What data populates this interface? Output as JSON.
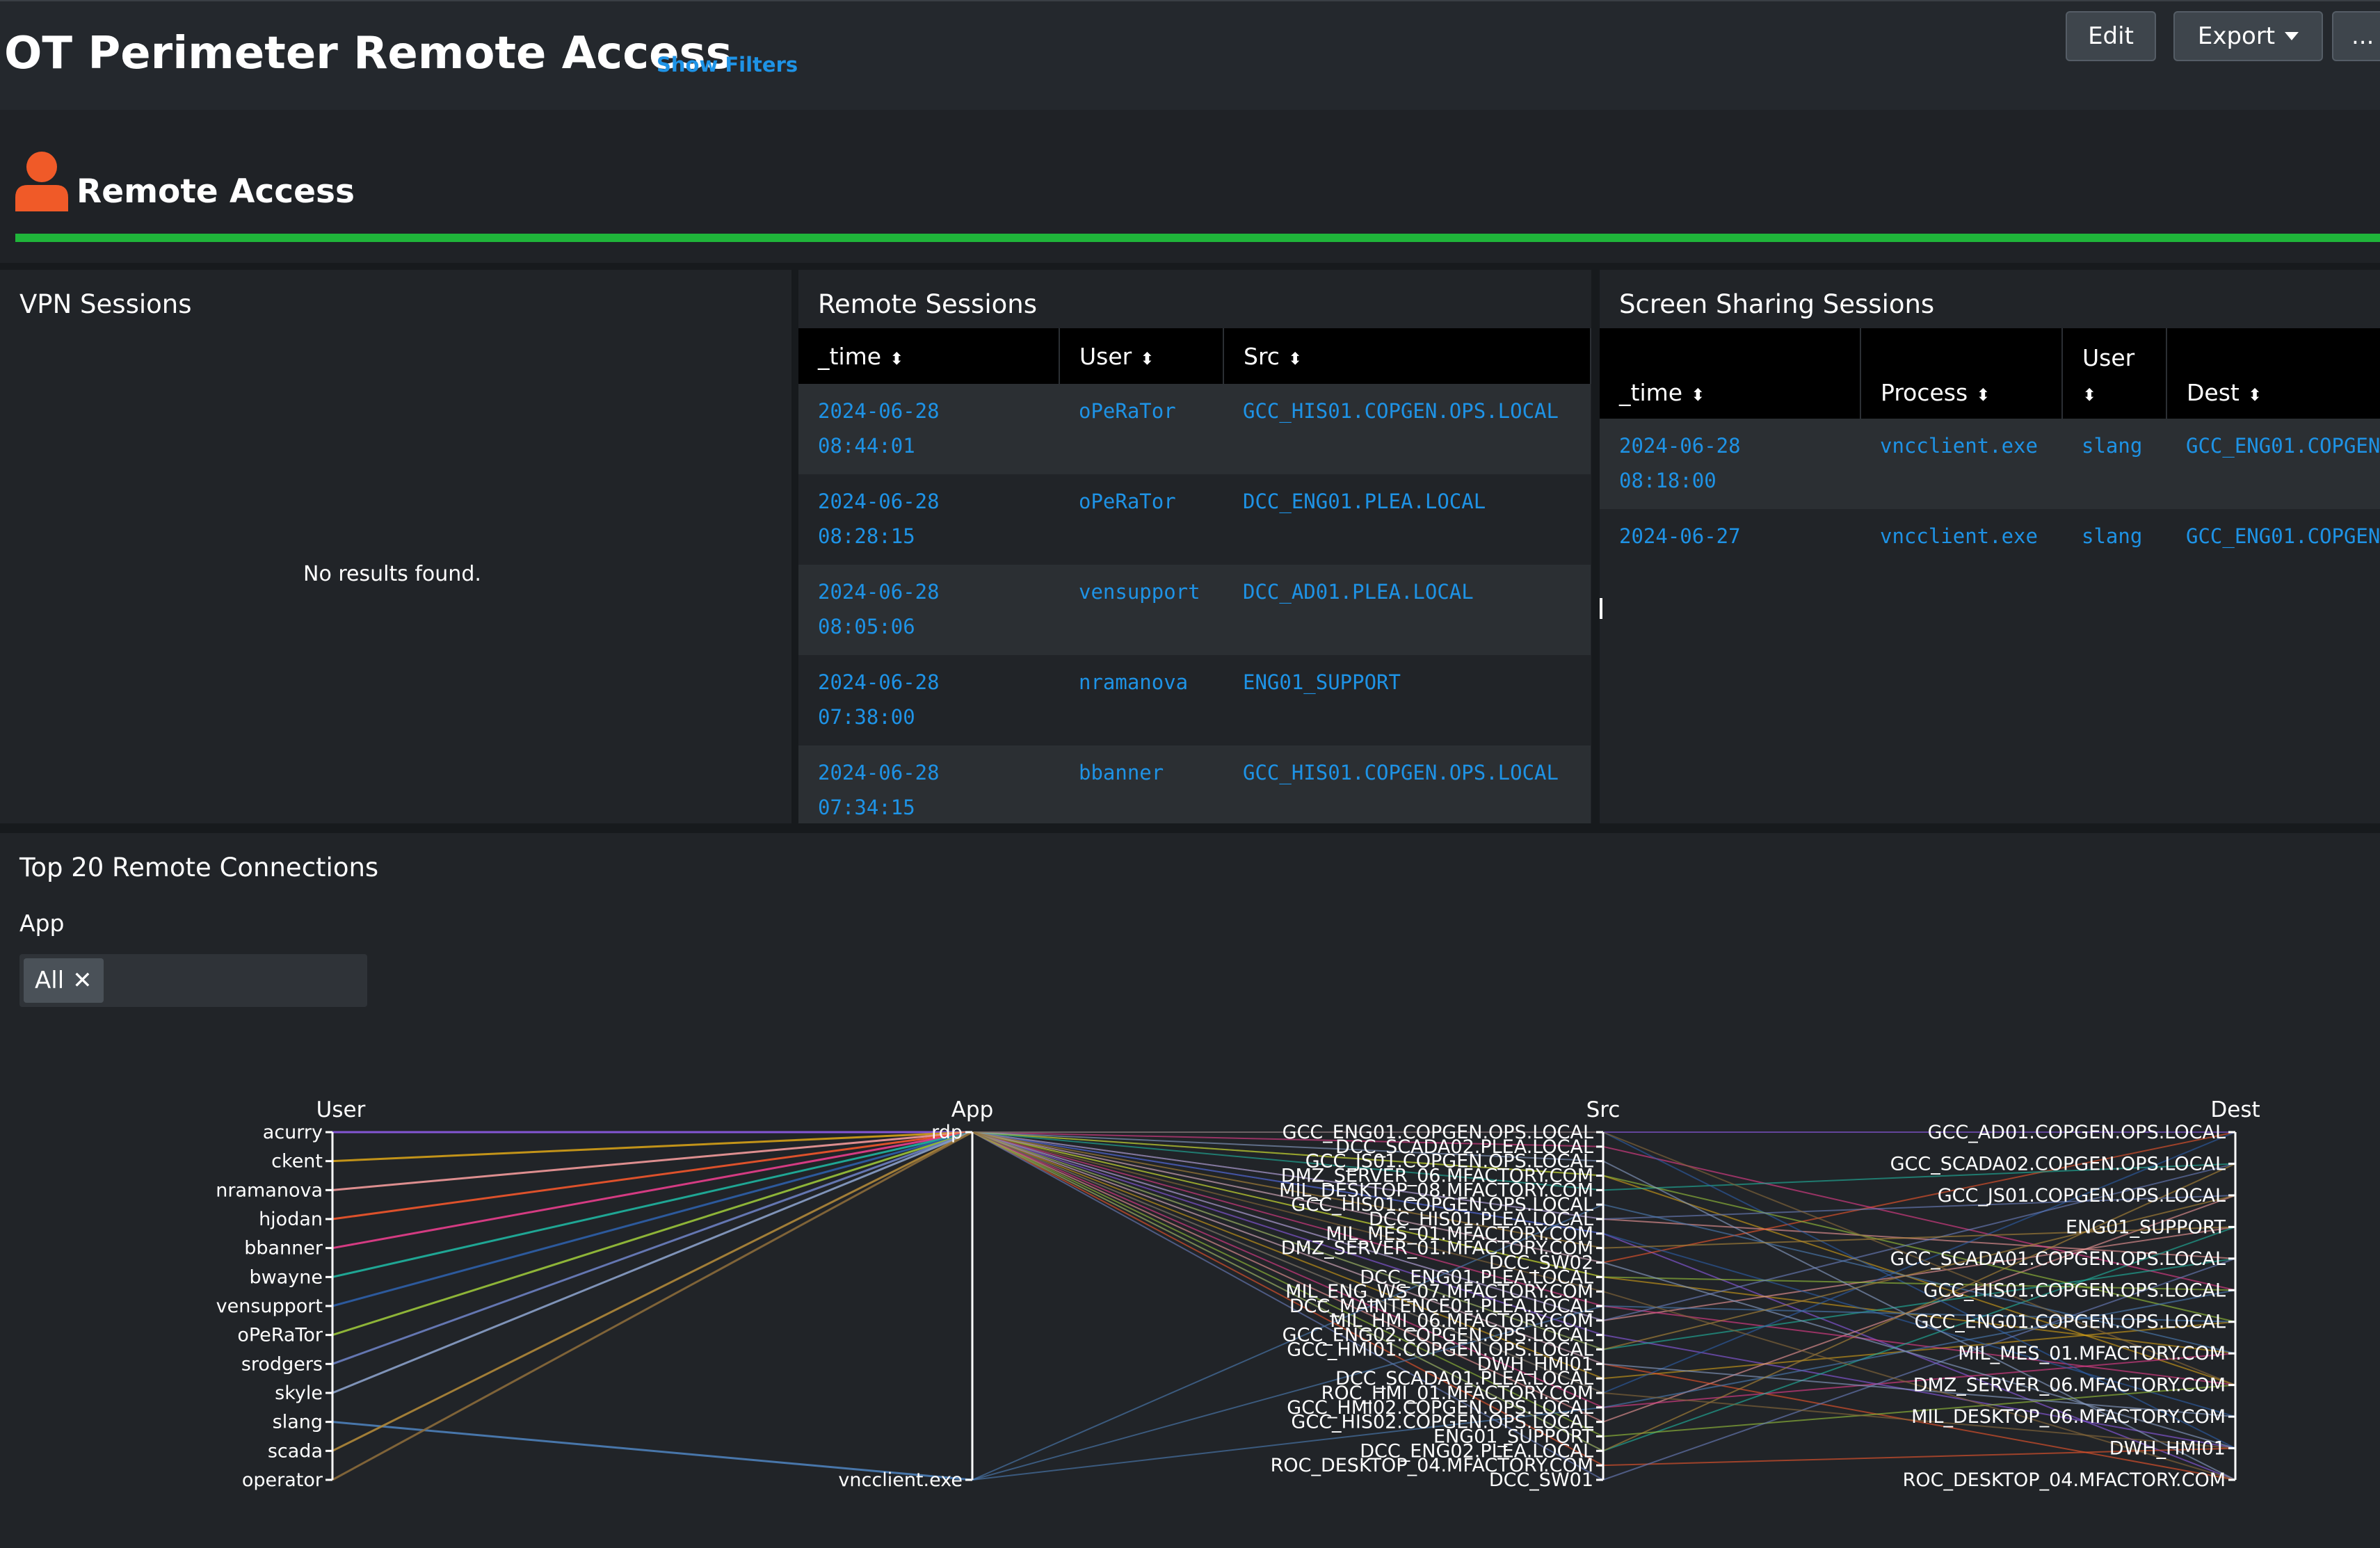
{
  "header": {
    "title": "OT Perimeter Remote Access",
    "show_filters": "Show Filters",
    "edit_label": "Edit",
    "export_label": "Export",
    "more_label": "..."
  },
  "section": {
    "title": "Remote Access",
    "accent_color": "#1fb53a",
    "icon": "person-icon",
    "icon_color": "#f05a28"
  },
  "vpn": {
    "title": "VPN Sessions",
    "empty": "No results found."
  },
  "remote_sessions": {
    "title": "Remote Sessions",
    "columns": [
      "_time",
      "User",
      "Src"
    ],
    "rows": [
      {
        "date": "2024-06-28",
        "time": "08:44:01",
        "user": "oPeRaTor",
        "src": "GCC_HIS01.COPGEN.OPS.LOCAL"
      },
      {
        "date": "2024-06-28",
        "time": "08:28:15",
        "user": "oPeRaTor",
        "src": "DCC_ENG01.PLEA.LOCAL"
      },
      {
        "date": "2024-06-28",
        "time": "08:05:06",
        "user": "vensupport",
        "src": "DCC_AD01.PLEA.LOCAL"
      },
      {
        "date": "2024-06-28",
        "time": "07:38:00",
        "user": "nramanova",
        "src": "ENG01_SUPPORT"
      },
      {
        "date": "2024-06-28",
        "time": "07:34:15",
        "user": "bbanner",
        "src": "GCC_HIS01.COPGEN.OPS.LOCAL"
      }
    ]
  },
  "screen_sharing": {
    "title": "Screen Sharing Sessions",
    "columns": [
      "_time",
      "Process",
      "User",
      "Dest"
    ],
    "rows": [
      {
        "date": "2024-06-28",
        "time": "08:18:00",
        "process": "vncclient.exe",
        "user": "slang",
        "dest": "GCC_ENG01.COPGEN"
      },
      {
        "date": "2024-06-27",
        "time": "",
        "process": "vncclient.exe",
        "user": "slang",
        "dest": "GCC_ENG01.COPGEN"
      }
    ]
  },
  "top_connections": {
    "title": "Top 20 Remote Connections",
    "filter_label": "App",
    "filter_token": "All"
  },
  "chart_data": {
    "type": "parallel_coordinates",
    "axes": [
      "User",
      "App",
      "Src",
      "Dest"
    ],
    "users": [
      "acurry",
      "ckent",
      "nramanova",
      "hjodan",
      "bbanner",
      "bwayne",
      "vensupport",
      "oPeRaTor",
      "srodgers",
      "skyle",
      "slang",
      "scada",
      "operator"
    ],
    "apps": [
      "rdp",
      "vncclient.exe"
    ],
    "srcs": [
      "GCC_ENG01.COPGEN.OPS.LOCAL",
      "DCC_SCADA02.PLEA.LOCAL",
      "GCC_JS01.COPGEN.OPS.LOCAL",
      "DMZ_SERVER_06.MFACTORY.COM",
      "MIL_DESKTOP_08.MFACTORY.COM",
      "GCC_HIS01.COPGEN.OPS.LOCAL",
      "DCC_HIS01.PLEA.LOCAL",
      "MIL_MES_01.MFACTORY.COM",
      "DMZ_SERVER_01.MFACTORY.COM",
      "DCC_SW02",
      "DCC_ENG01.PLEA.LOCAL",
      "MIL_ENG_WS_07.MFACTORY.COM",
      "DCC_MAINTENCE01.PLEA.LOCAL",
      "MIL_HMI_06.MFACTORY.COM",
      "GCC_ENG02.COPGEN.OPS.LOCAL",
      "GCC_HMI01.COPGEN.OPS.LOCAL",
      "DWH_HMI01",
      "DCC_SCADA01.PLEA.LOCAL",
      "ROC_HMI_01.MFACTORY.COM",
      "GCC_HMI02.COPGEN.OPS.LOCAL",
      "GCC_HIS02.COPGEN.OPS.LOCAL",
      "ENG01_SUPPORT",
      "DCC_ENG02.PLEA.LOCAL",
      "ROC_DESKTOP_04.MFACTORY.COM",
      "DCC_SW01"
    ],
    "dests": [
      "GCC_AD01.COPGEN.OPS.LOCAL",
      "GCC_SCADA02.COPGEN.OPS.LOCAL",
      "GCC_JS01.COPGEN.OPS.LOCAL",
      "ENG01_SUPPORT",
      "GCC_SCADA01.COPGEN.OPS.LOCAL",
      "GCC_HIS01.COPGEN.OPS.LOCAL",
      "GCC_ENG01.COPGEN.OPS.LOCAL",
      "MIL_MES_01.MFACTORY.COM",
      "DMZ_SERVER_06.MFACTORY.COM",
      "MIL_DESKTOP_06.MFACTORY.COM",
      "DWH_HMI01",
      "ROC_DESKTOP_04.MFACTORY.COM"
    ],
    "user_colors": [
      "#8e5ce6",
      "#d4a017",
      "#f29a9a",
      "#f2572b",
      "#e83e8c",
      "#1fb5a0",
      "#2d5fa8",
      "#9ac43a",
      "#6c80c0",
      "#8aa0c8",
      "#4d7fb8",
      "#b08838",
      "#8a6a3a"
    ],
    "user_app": [
      0,
      0,
      0,
      0,
      0,
      0,
      0,
      0,
      0,
      0,
      1,
      0,
      0
    ]
  }
}
